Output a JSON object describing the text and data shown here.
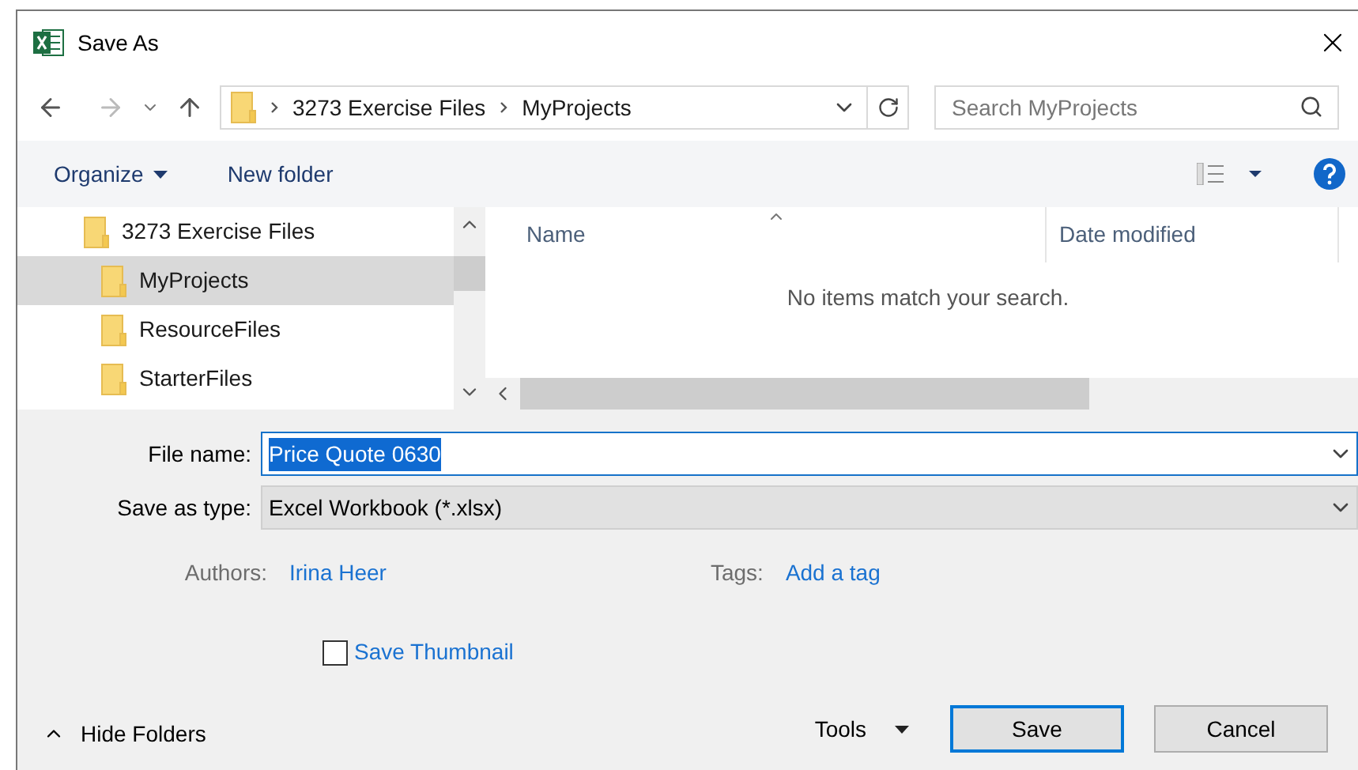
{
  "window": {
    "title": "Save As"
  },
  "address": {
    "crumbs": [
      "3273 Exercise Files",
      "MyProjects"
    ]
  },
  "search": {
    "placeholder": "Search MyProjects"
  },
  "toolbar": {
    "organize": "Organize",
    "new_folder": "New folder"
  },
  "tree": [
    {
      "label": "3273 Exercise Files",
      "selected": false,
      "children": [
        {
          "label": "MyProjects",
          "selected": true
        },
        {
          "label": "ResourceFiles",
          "selected": false
        },
        {
          "label": "StarterFiles",
          "selected": false
        }
      ]
    }
  ],
  "table": {
    "columns": [
      "Name",
      "Date modified"
    ],
    "empty_message": "No items match your search."
  },
  "file_name": {
    "label": "File name:",
    "value": "Price Quote 0630",
    "selected": true
  },
  "save_as_type": {
    "label": "Save as type:",
    "value": "Excel Workbook (*.xlsx)"
  },
  "authors": {
    "label": "Authors:",
    "value": "Irina Heer"
  },
  "tags": {
    "label": "Tags:",
    "value": "Add a tag"
  },
  "save_thumbnail": {
    "label": "Save Thumbnail",
    "checked": false
  },
  "hide_folders": "Hide Folders",
  "tools": "Tools",
  "buttons": [
    {
      "label": "Save",
      "kind": "primary"
    },
    {
      "label": "Cancel",
      "kind": "secondary"
    }
  ]
}
